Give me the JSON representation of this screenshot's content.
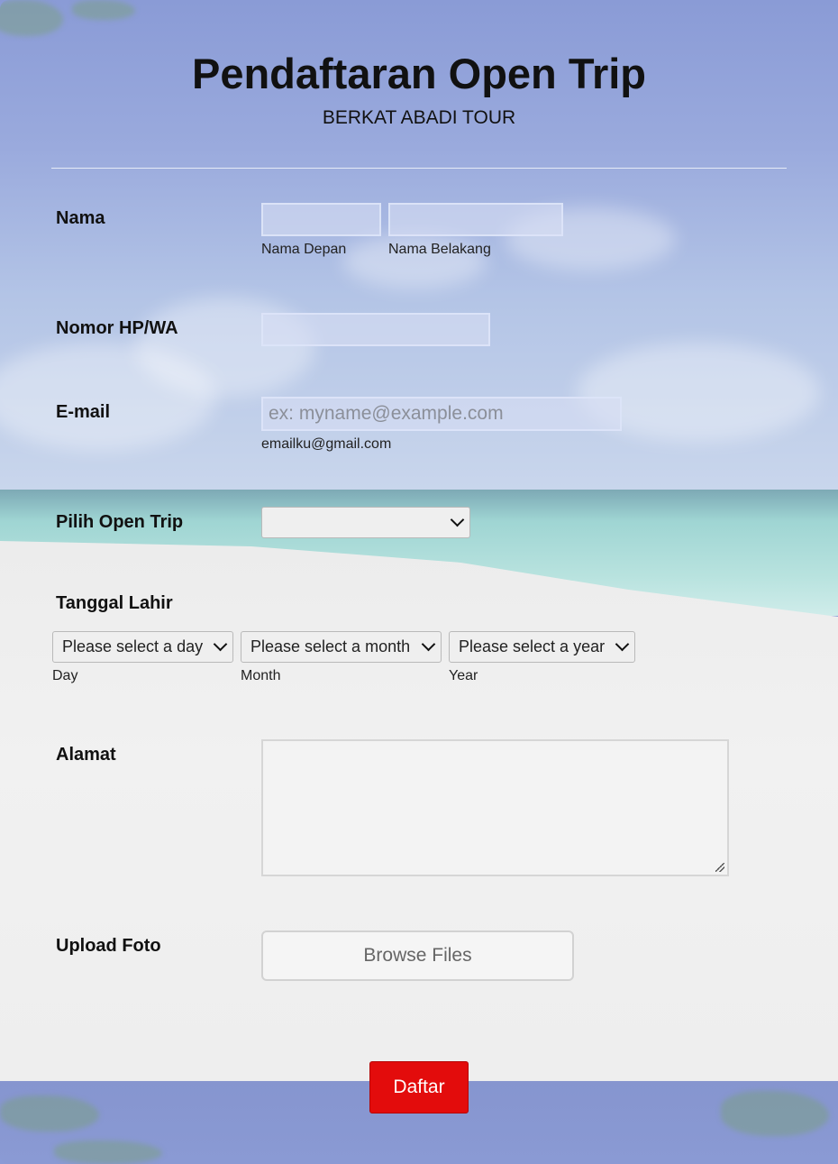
{
  "header": {
    "title": "Pendaftaran Open Trip",
    "subtitle": "BERKAT ABADI TOUR"
  },
  "fields": {
    "nama": {
      "label": "Nama",
      "first_sublabel": "Nama Depan",
      "last_sublabel": "Nama Belakang",
      "first_value": "",
      "last_value": ""
    },
    "phone": {
      "label": "Nomor HP/WA",
      "value": ""
    },
    "email": {
      "label": "E-mail",
      "placeholder": "ex: myname@example.com",
      "sublabel": "emailku@gmail.com",
      "value": ""
    },
    "trip": {
      "label": "Pilih Open Trip",
      "selected": ""
    },
    "birthdate": {
      "label": "Tanggal Lahir",
      "day_placeholder": "Please select a day",
      "month_placeholder": "Please select a month",
      "year_placeholder": "Please select a year",
      "day_sublabel": "Day",
      "month_sublabel": "Month",
      "year_sublabel": "Year"
    },
    "address": {
      "label": "Alamat",
      "value": ""
    },
    "photo": {
      "label": "Upload Foto",
      "button_label": "Browse Files"
    }
  },
  "submit": {
    "label": "Daftar"
  },
  "colors": {
    "submit_bg": "#e30c0c",
    "sky": "#8a9bd6",
    "sand": "#efefef"
  },
  "icons": {
    "dropdown": "chevron-down-icon",
    "resize": "resize-grip-icon"
  }
}
